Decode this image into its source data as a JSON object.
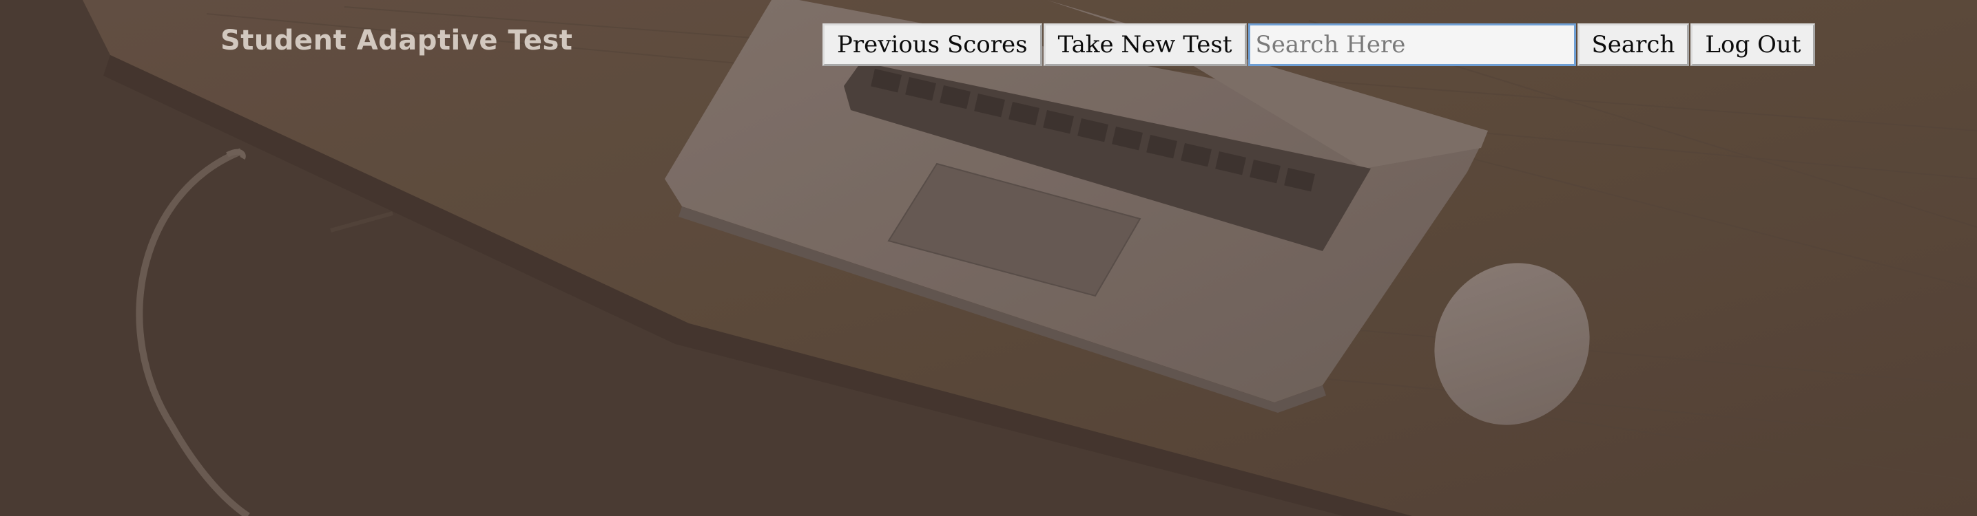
{
  "header": {
    "brand": "Student Adaptive Test"
  },
  "nav": {
    "previous_scores_label": "Previous Scores",
    "take_new_test_label": "Take New Test",
    "search_placeholder": "Search Here",
    "search_value": "",
    "search_button_label": "Search",
    "logout_label": "Log Out"
  },
  "background": {
    "subject": "laptop-and-mouse-on-wooden-desk-photo",
    "tint_color": "#4e4037"
  }
}
